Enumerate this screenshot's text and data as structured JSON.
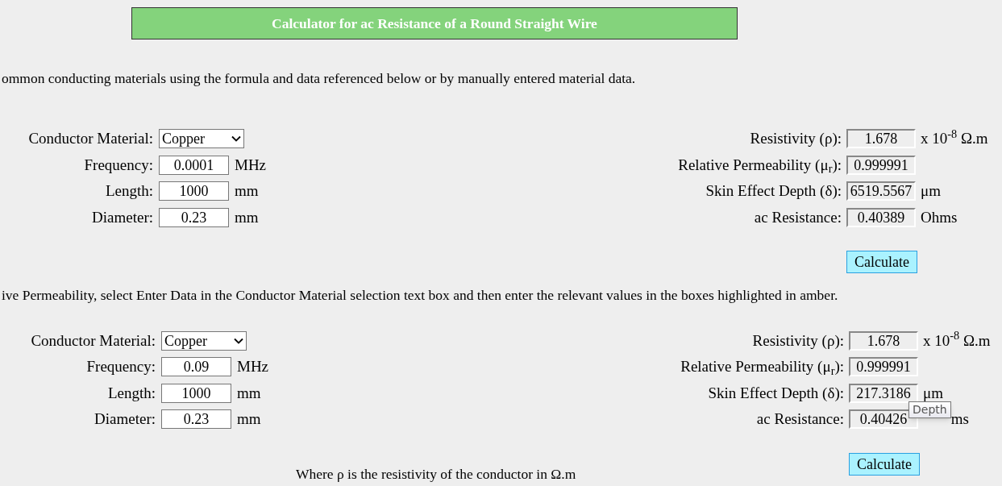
{
  "title": "Calculator for ac Resistance of a Round Straight Wire",
  "intro": "ommon conducting materials using the formula and data referenced below or by manually entered material data.",
  "sections": [
    {
      "inputs": [
        {
          "kind": "select",
          "label": "Conductor Material:",
          "value": "Copper"
        },
        {
          "kind": "text",
          "label": "Frequency:",
          "value": "0.0001",
          "unit": "MHz"
        },
        {
          "kind": "text",
          "label": "Length:",
          "value": "1000",
          "unit": "mm"
        },
        {
          "kind": "text",
          "label": "Diameter:",
          "value": "0.23",
          "unit": "mm"
        }
      ],
      "outputs": [
        {
          "label": "Resistivity (ρ):",
          "value": "1.678",
          "unit": "x 10$^{-8}$ Ω.m"
        },
        {
          "label": "Relative Permeability (μ$_{r}$):",
          "value": "0.999991"
        },
        {
          "label": "Skin Effect Depth (δ):",
          "value": "6519.5567",
          "unit": "μm"
        },
        {
          "label": "ac Resistance:",
          "value": "0.40389",
          "unit": "Ohms"
        }
      ],
      "button": "Calculate"
    },
    {
      "inputs": [
        {
          "kind": "select",
          "label": "Conductor Material:",
          "value": "Copper"
        },
        {
          "kind": "text",
          "label": "Frequency:",
          "value": "0.09",
          "unit": "MHz"
        },
        {
          "kind": "text",
          "label": "Length:",
          "value": "1000",
          "unit": "mm"
        },
        {
          "kind": "text",
          "label": "Diameter:",
          "value": "0.23",
          "unit": "mm"
        }
      ],
      "outputs": [
        {
          "label": "Resistivity (ρ):",
          "value": "1.678",
          "unit": "x 10$^{-8}$ Ω.m"
        },
        {
          "label": "Relative Permeability (μ$_{r}$):",
          "value": "0.999991"
        },
        {
          "label": "Skin Effect Depth (δ):",
          "value": "217.3186",
          "unit": "μm"
        },
        {
          "label": "ac Resistance:",
          "value": "0.40426",
          "tooltip": "Depth",
          "unit": "ms"
        }
      ],
      "button": "Calculate"
    }
  ],
  "instructions": "ive Permeability, select Enter Data in the Conductor Material selection text box and then enter the relevant values in the boxes highlighted in amber.",
  "footer_text": "Where ρ is the resistivity of the conductor in Ω.m"
}
